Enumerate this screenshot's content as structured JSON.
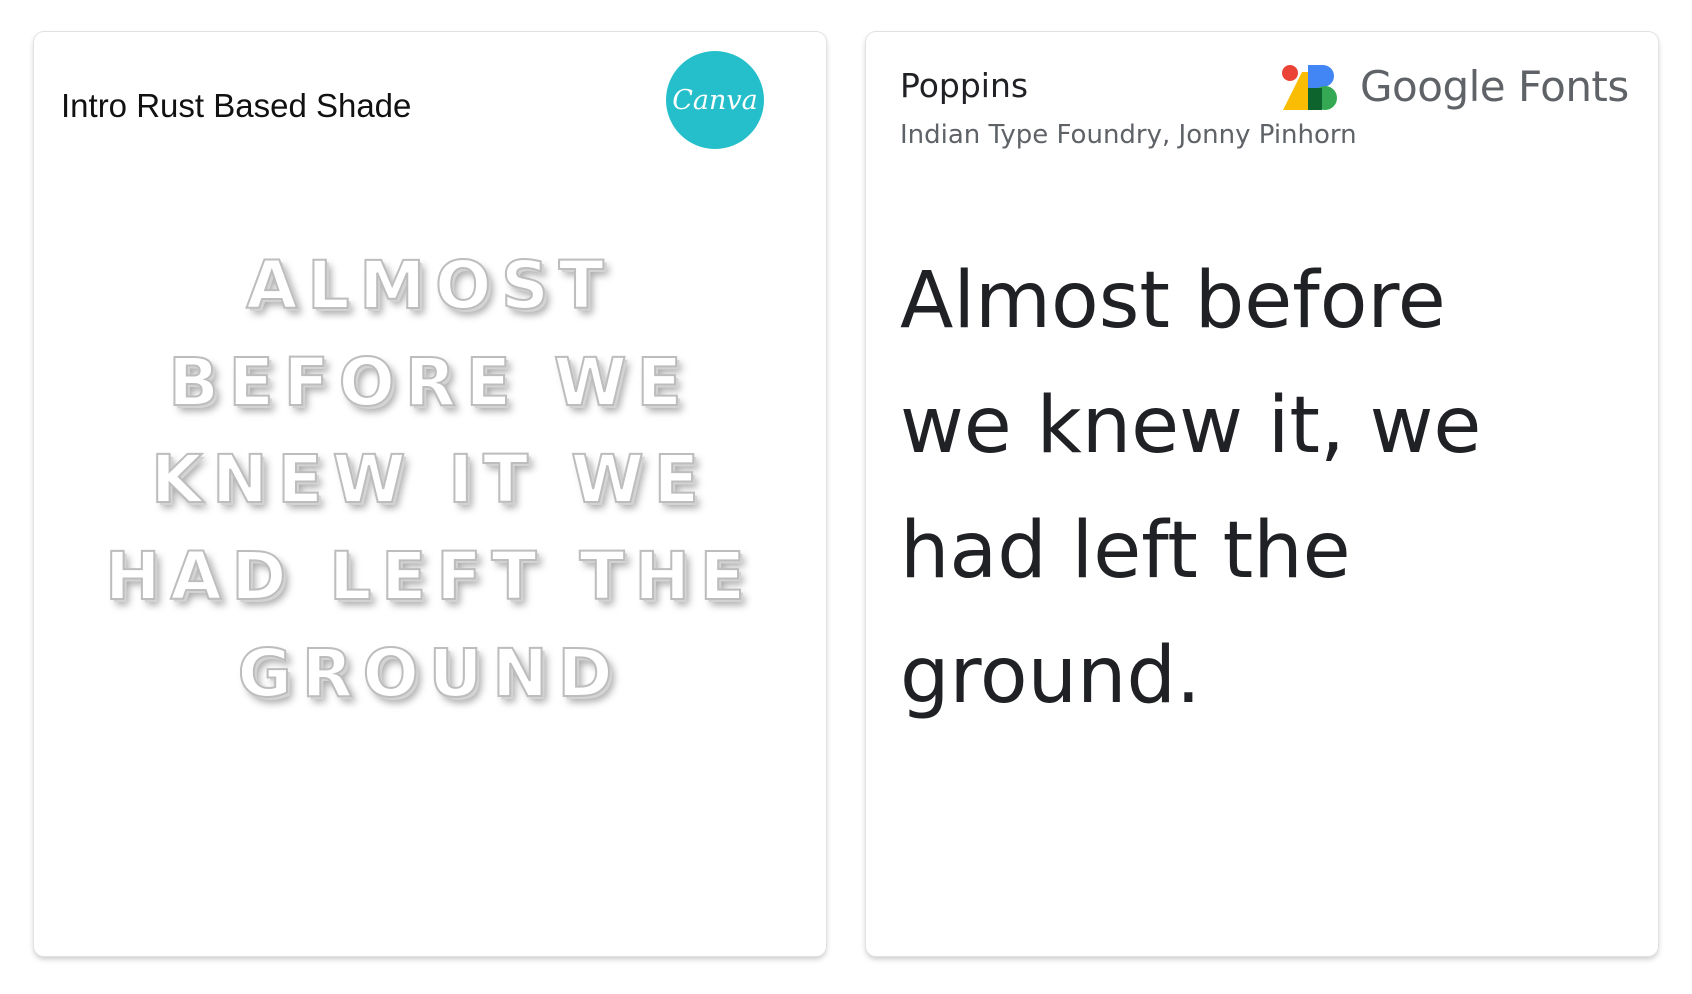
{
  "left_card": {
    "title": "Intro Rust Based Shade",
    "logo_text": "Canva",
    "logo_color": "#24bfca",
    "sample_lines": [
      "ALMOST",
      "BEFORE WE",
      "KNEW IT WE",
      "HAD LEFT THE",
      "GROUND"
    ]
  },
  "right_card": {
    "font_name": "Poppins",
    "designers": "Indian Type Foundry, Jonny Pinhorn",
    "brand": "Google Fonts",
    "brand_icon": "google-fonts-icon",
    "sample_lines": [
      "Almost before",
      "we knew it, we",
      "had left the",
      "ground."
    ]
  }
}
